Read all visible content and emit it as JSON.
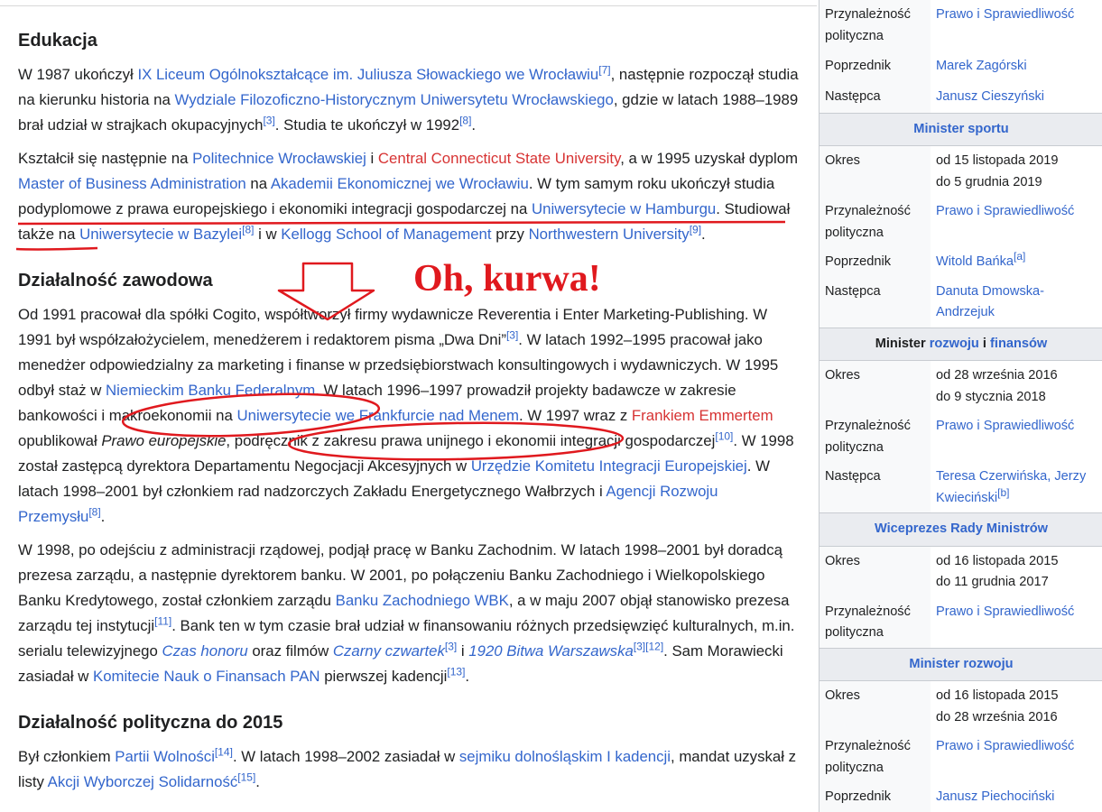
{
  "sections": {
    "edukacja": {
      "heading": "Edukacja",
      "p1": {
        "t1": "W 1987 ukończył ",
        "l1": "IX Liceum Ogólnokształcące im. Juliusza Słowackiego we Wrocławiu",
        "s1": "[7]",
        "t2": ", następnie rozpoczął studia na kierunku historia na ",
        "l2": "Wydziale Filozoficzno-Historycznym Uniwersytetu Wrocławskiego",
        "t3": ", gdzie w latach 1988–1989 brał udział w strajkach okupacyjnych",
        "s2": "[3]",
        "t4": ". Studia te ukończył w 1992",
        "s3": "[8]",
        "t5": "."
      },
      "p2": {
        "t1": "Kształcił się następnie na ",
        "l1": "Politechnice Wrocławskiej",
        "t2": " i ",
        "l2": "Central Connecticut State University",
        "t3": ", a w 1995 uzyskał dyplom ",
        "l3": "Master of Business Administration",
        "t4": " na ",
        "l4": "Akademii Ekonomicznej we Wrocławiu",
        "t5": ". W tym samym roku ukończył studia podyplomowe z prawa europejskiego i ekonomiki integracji gospodarczej na ",
        "l5": "Uniwersytecie w Hamburgu",
        "t6": ". Studiował także na ",
        "l6": "Uniwersytecie w Bazylei",
        "s1": "[8]",
        "t7": " i w ",
        "l7": "Kellogg School of Management",
        "t8": " przy ",
        "l8": "Northwestern University",
        "s2": "[9]",
        "t9": "."
      }
    },
    "zawodowa": {
      "heading": "Działalność zawodowa",
      "p1": {
        "t1": "Od 1991 pracował dla spółki Cogito, współtworzył firmy wydawnicze Reverentia i Enter Marketing-Publishing. W 1991 był współzałożycielem, menedżerem i redaktorem pisma „Dwa Dni”",
        "s1": "[3]",
        "t2": ". W latach 1992–1995 pracował jako menedżer odpowiedzialny za marketing i finanse w przedsiębiorstwach konsultingowych i wydawniczych. W 1995 odbył staż w ",
        "l1": "Niemieckim Banku Federalnym",
        "t3": ". W latach 1996–1997 prowadził projekty badawcze w zakresie bankowości i makroekonomii na ",
        "l2": "Uniwersytecie we Frankfurcie nad Menem",
        "t4": ". W 1997 wraz z ",
        "l3": "Frankiem Emmertem",
        "t5": " opublikował ",
        "i1": "Prawo europejskie",
        "t6": ", podręcznik z zakresu prawa unijnego i ekonomii integracji gospodarczej",
        "s2": "[10]",
        "t7": ". W 1998 został zastępcą dyrektora Departamentu Negocjacji Akcesyjnych w ",
        "l4": "Urzędzie Komitetu Integracji Europejskiej",
        "t8": ". W latach 1998–2001 był członkiem rad nadzorczych Zakładu Energetycznego Wałbrzych i ",
        "l5": "Agencji Rozwoju Przemysłu",
        "s3": "[8]",
        "t9": "."
      },
      "p2": {
        "t1": "W 1998, po odejściu z administracji rządowej, podjął pracę w Banku Zachodnim. W latach 1998–2001 był doradcą prezesa zarządu, a następnie dyrektorem banku. W 2001, po połączeniu Banku Zachodniego i Wielkopolskiego Banku Kredytowego, został członkiem zarządu ",
        "l1": "Banku Zachodniego WBK",
        "t2": ", a w maju 2007 objął stanowisko prezesa zarządu tej instytucji",
        "s1": "[11]",
        "t3": ". Bank ten w tym czasie brał udział w finansowaniu różnych przedsięwzięć kulturalnych, m.in. serialu telewizyjnego ",
        "l2": "Czas honoru",
        "t4": " oraz filmów ",
        "l3": "Czarny czwartek",
        "s2": "[3]",
        "t5": " i ",
        "l4": "1920 Bitwa Warszawska",
        "s3": "[3]",
        "s4": "[12]",
        "t6": ". Sam Morawiecki zasiadał w ",
        "l5": "Komitecie Nauk o Finansach PAN",
        "t7": " pierwszej kadencji",
        "s5": "[13]",
        "t8": "."
      }
    },
    "polityczna": {
      "heading": "Działalność polityczna do 2015",
      "p1": {
        "t1": "Był członkiem ",
        "l1": "Partii Wolności",
        "s1": "[14]",
        "t2": ". W latach 1998–2002 zasiadał w ",
        "l2": "sejmiku dolnośląskim I kadencji",
        "t3": ", mandat uzyskał z listy ",
        "l3": "Akcji Wyborczej Solidarność",
        "s2": "[15]",
        "t4": "."
      }
    }
  },
  "annotation": {
    "text": "Oh, kurwa!",
    "color": "#e0191e"
  },
  "infobox": {
    "top": {
      "party_label": "Przynależność polityczna",
      "party_value": "Prawo i Sprawiedliwość",
      "pred_label": "Poprzednik",
      "pred_value": "Marek Zagórski",
      "succ_label": "Następca",
      "succ_value": "Janusz Cieszyński"
    },
    "sport": {
      "title": "Minister sportu",
      "term_label": "Okres",
      "term_from": "od 15 listopada 2019",
      "term_to": "do 5 grudnia 2019",
      "party_label": "Przynależność polityczna",
      "party_value": "Prawo i Sprawiedliwość",
      "pred_label": "Poprzednik",
      "pred_value": "Witold Bańka",
      "pred_note": "[a]",
      "succ_label": "Następca",
      "succ_value": "Danuta Dmowska-Andrzejuk"
    },
    "rozwoj_finanse": {
      "title_a": "Minister ",
      "title_b": "rozwoju",
      "title_c": " i ",
      "title_d": "finansów",
      "term_label": "Okres",
      "term_from": "od 28 września 2016",
      "term_to": "do 9 stycznia 2018",
      "party_label": "Przynależność polityczna",
      "party_value": "Prawo i Sprawiedliwość",
      "succ_label": "Następca",
      "succ_value": "Teresa Czerwińska, Jerzy Kwieciński",
      "succ_note": "[b]"
    },
    "wicepremier": {
      "title": "Wiceprezes Rady Ministrów",
      "term_label": "Okres",
      "term_from": "od 16 listopada 2015",
      "term_to": "do 11 grudnia 2017",
      "party_label": "Przynależność polityczna",
      "party_value": "Prawo i Sprawiedliwość"
    },
    "rozwoj": {
      "title": "Minister rozwoju",
      "term_label": "Okres",
      "term_from": "od 16 listopada 2015",
      "term_to": "do 28 września 2016",
      "party_label": "Przynależność polityczna",
      "party_value": "Prawo i Sprawiedliwość",
      "pred_label": "Poprzednik",
      "pred_value": "Janusz Piechociński"
    }
  }
}
